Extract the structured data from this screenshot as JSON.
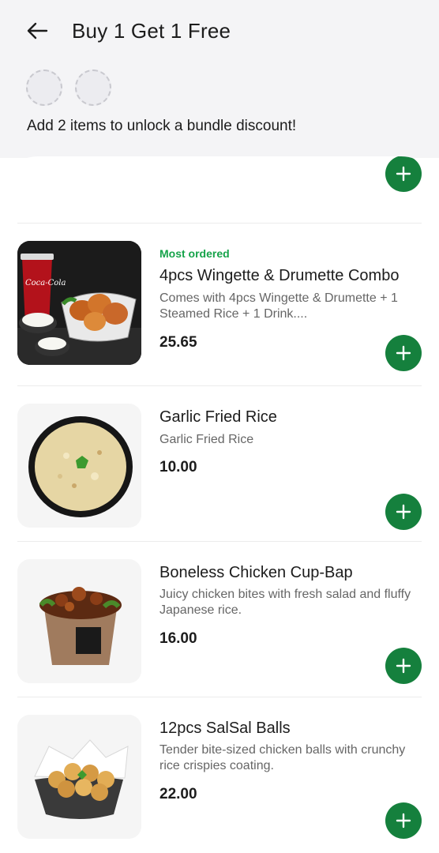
{
  "header": {
    "title": "Buy 1 Get 1 Free",
    "unlock_message": "Add 2 items to unlock a bundle discount!"
  },
  "colors": {
    "accent": "#15803d",
    "badge": "#16a34a"
  },
  "items": [
    {
      "badge": "Most ordered",
      "name": "4pcs Wingette & Drumette Combo",
      "description": "Comes with 4pcs Wingette & Drumette + 1 Steamed Rice + 1 Drink....",
      "price": "25.65",
      "image": "wings-combo-image"
    },
    {
      "badge": "",
      "name": "Garlic Fried Rice",
      "description": "Garlic Fried Rice",
      "price": "10.00",
      "image": "garlic-rice-image"
    },
    {
      "badge": "",
      "name": "Boneless Chicken Cup-Bap",
      "description": "Juicy chicken bites with fresh salad and fluffy Japanese rice.",
      "price": "16.00",
      "image": "cupbap-image"
    },
    {
      "badge": "",
      "name": "12pcs SalSal Balls",
      "description": "Tender bite-sized chicken balls with crunchy rice crispies coating.",
      "price": "22.00",
      "image": "salsal-balls-image"
    }
  ]
}
